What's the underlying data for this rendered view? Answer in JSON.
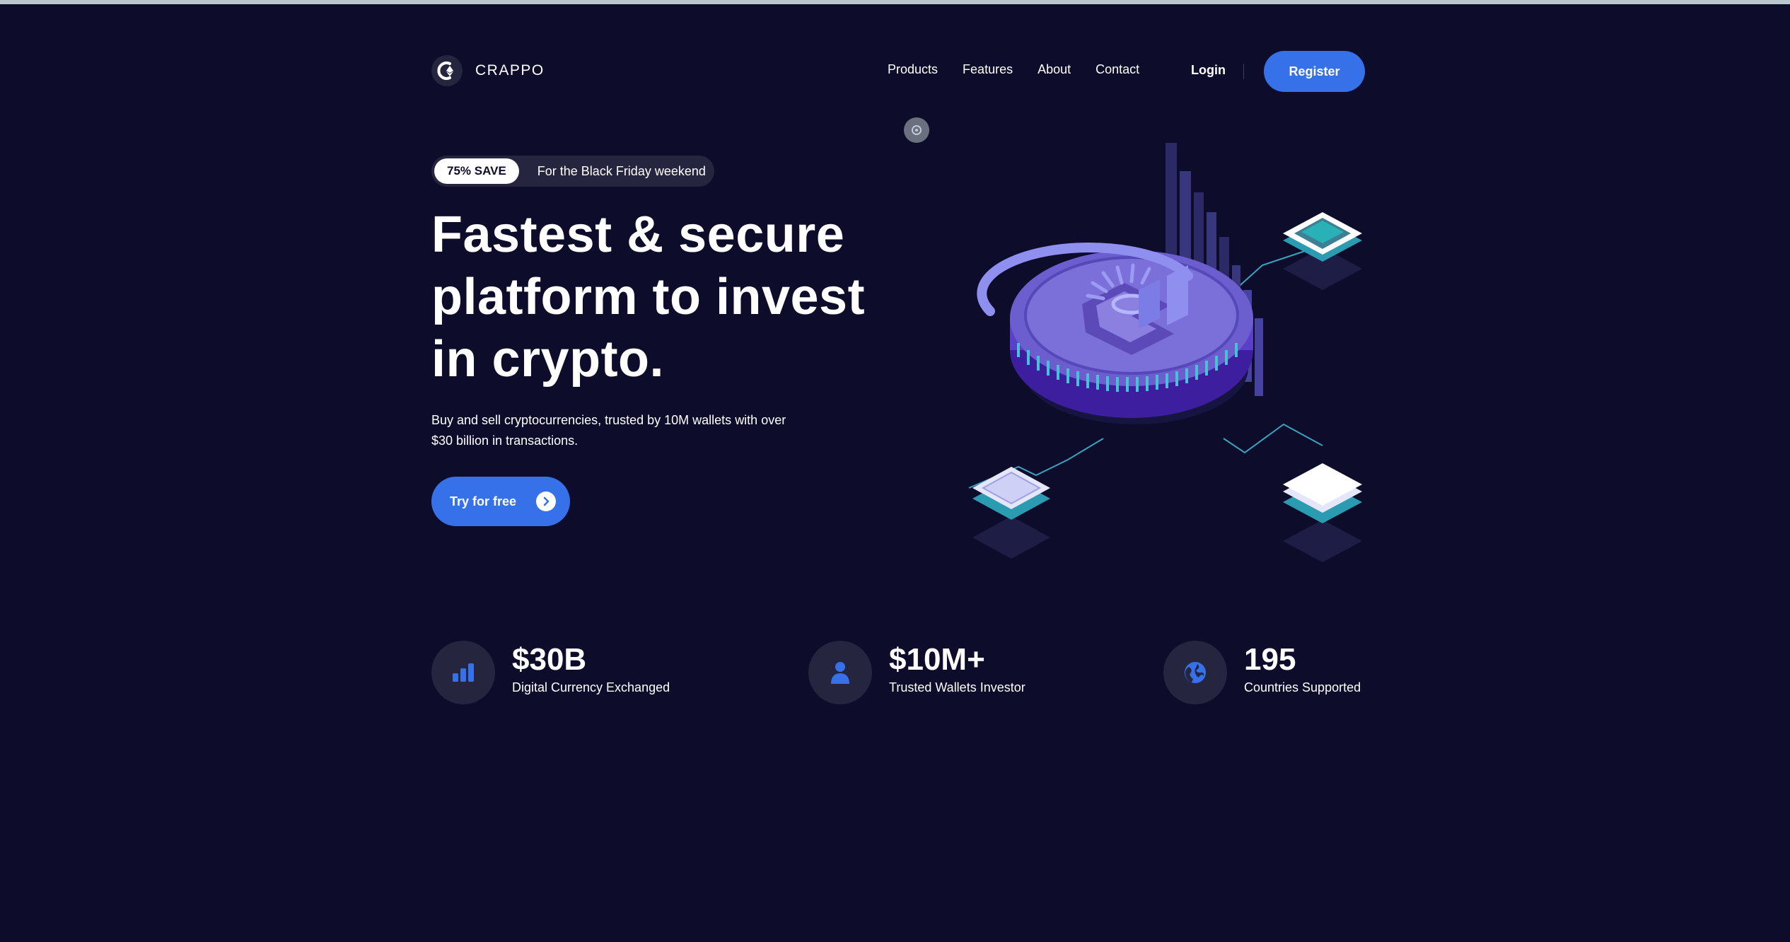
{
  "brand": {
    "name": "CRAPPO"
  },
  "nav": {
    "links": [
      "Products",
      "Features",
      "About",
      "Contact"
    ],
    "login_label": "Login",
    "register_label": "Register"
  },
  "hero": {
    "promo_badge": "75% SAVE",
    "promo_text": "For the Black Friday weekend",
    "headline_lines": [
      "Fastest & secure",
      "platform to invest",
      "in crypto."
    ],
    "subtext": "Buy and sell cryptocurrencies, trusted by 10M wallets with over $30 billion in transactions.",
    "cta_label": "Try for free"
  },
  "stats": [
    {
      "value": "$30B",
      "label": "Digital Currency Exchanged",
      "icon": "bar-chart-icon"
    },
    {
      "value": "$10M+",
      "label": "Trusted Wallets Investor",
      "icon": "user-icon"
    },
    {
      "value": "195",
      "label": "Countries Supported",
      "icon": "globe-icon"
    }
  ],
  "colors": {
    "background": "#0d0d2b",
    "accent": "#3671e9",
    "surface": "#25253f",
    "illustration_purple": "#6c5ecf"
  }
}
